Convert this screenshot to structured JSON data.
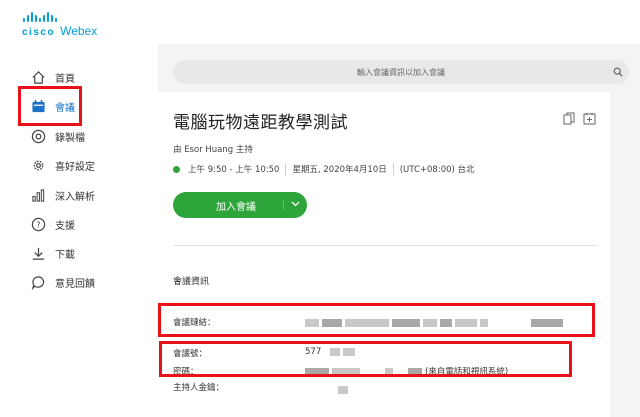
{
  "brand": {
    "cisco": "cisco",
    "webex": "Webex",
    "color": "#049fd9"
  },
  "sidebar": {
    "items": [
      {
        "label": "首頁",
        "icon": "home-icon"
      },
      {
        "label": "會議",
        "icon": "calendar-icon",
        "active": true
      },
      {
        "label": "錄製檔",
        "icon": "recording-icon"
      },
      {
        "label": "喜好設定",
        "icon": "gear-icon"
      },
      {
        "label": "深入解析",
        "icon": "analytics-icon"
      },
      {
        "label": "支援",
        "icon": "help-icon"
      },
      {
        "label": "下載",
        "icon": "download-icon"
      },
      {
        "label": "意見回饋",
        "icon": "feedback-icon"
      }
    ]
  },
  "search": {
    "placeholder": "輸入會議資訊以加入會議",
    "icon": "search-icon"
  },
  "meeting": {
    "title": "電腦玩物遠距教學測試",
    "host": "由 Esor Huang 主持",
    "time": "上午 9:50 - 上午 10:50",
    "date": "星期五, 2020年4月10日",
    "timezone": "(UTC+08:00) 台北",
    "join_label": "加入會議",
    "status_color": "#2ea53a"
  },
  "info": {
    "section_title": "會議資訊",
    "link_label": "會議鏈結：",
    "number_label": "會議號：",
    "number_value": "577",
    "password_label": "密碼：",
    "password_suffix": "(來自電話和視訊系統)",
    "host_key_label": "主持人金鑰："
  },
  "highlight_color": "#e8121b"
}
